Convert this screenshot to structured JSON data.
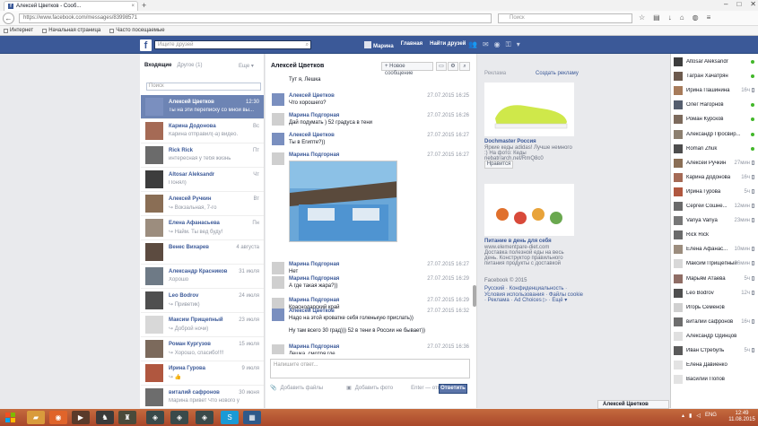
{
  "browser": {
    "tab_title": "Алексей Цветков - Сооб...",
    "new_tab": "+",
    "url": "https://www.facebook.com/messages/83998571",
    "search_placeholder": "Поиск",
    "bookmarks": [
      "Интернет",
      "Начальная страница",
      "Часто посещаемые"
    ]
  },
  "fb_header": {
    "logo": "f",
    "search_placeholder": "Ищите друзей",
    "nav": [
      "Марина",
      "Главная",
      "Найти друзей"
    ]
  },
  "left": {
    "tab_inbox": "Входящие",
    "tab_others": "Другое (1)",
    "tab_more": "Еще ▾",
    "search_placeholder": "Поиск",
    "conversations": [
      {
        "name": "Алексей Цветков",
        "snippet": "Ты на эти переписку со мной вы...",
        "time": "12:30",
        "color": "#7a8fbf"
      },
      {
        "name": "Карина Додонова",
        "snippet": "Карина отправил(-а) видео.",
        "time": "Вс",
        "color": "#a56a55"
      },
      {
        "name": "Rick Rick",
        "snippet": "интересная у тебя жизнь",
        "time": "Пт",
        "color": "#6b6b6b"
      },
      {
        "name": "Altosar Aleksandr",
        "snippet": "Понял)",
        "time": "Чт",
        "color": "#3d3d3d"
      },
      {
        "name": "Алексей Ручкин",
        "snippet": "↪ Вокзальная, 7-го",
        "time": "Вт",
        "color": "#8a6e55"
      },
      {
        "name": "Елена Афанасьева",
        "snippet": "↪ Найм. Ты вед буду!",
        "time": "Пн",
        "color": "#9c8d7e"
      },
      {
        "name": "Венес Вихарев",
        "snippet": "",
        "time": "4 августа",
        "color": "#5c4b40"
      },
      {
        "name": "Александр Красников",
        "snippet": "Хорошо",
        "time": "31 июля",
        "color": "#6e7a86"
      },
      {
        "name": "Leo Bodrov",
        "snippet": "↪ Приветик)",
        "time": "24 июля",
        "color": "#4f4f4f"
      },
      {
        "name": "Максим Прищепный",
        "snippet": "↪ Доброй ночи)",
        "time": "23 июля",
        "color": "#d8d8d8"
      },
      {
        "name": "Роман Кургузов",
        "snippet": "↪ Хорошо, спасибо!!!!",
        "time": "15 июля",
        "color": "#7c6a5c"
      },
      {
        "name": "Ирина Гурова",
        "snippet": "↪ 👍",
        "time": "9 июля",
        "color": "#b0573f"
      },
      {
        "name": "виталий сафронов",
        "snippet": "Марина привет Что нового у",
        "time": "30 июня",
        "color": "#6d6d6d"
      }
    ]
  },
  "chat": {
    "title": "Алексей Цветков",
    "new_message": "+ Новое сообщение",
    "messages": [
      {
        "author": "",
        "text": "Тут я, Лешка",
        "time": "",
        "ava": ""
      },
      {
        "author": "Алексей Цветков",
        "text": "Что хорошего?",
        "time": "27.07.2015 16:25",
        "ava": "#7a8fbf"
      },
      {
        "author": "Марина Подгорная",
        "text": "Дай подумать ) 52 градуса в тени",
        "time": "27.07.2015 16:26",
        "ava": "#cfcfcf"
      },
      {
        "author": "Алексей Цветков",
        "text": "Ты в Египте?))",
        "time": "27.07.2015 16:27",
        "ava": "#7a8fbf"
      },
      {
        "author": "Марина Подгорная",
        "text": "",
        "time": "27.07.2015 16:27",
        "ava": "#cfcfcf"
      },
      {
        "author": "Марина Подгорная",
        "text": "Нет",
        "time": "27.07.2015 16:27",
        "ava": "#cfcfcf"
      },
      {
        "author": "Марина Подгорная",
        "text": "А где такая жара?))",
        "time": "27.07.2015 16:29",
        "ava": "#cfcfcf"
      },
      {
        "author": "Марина Подгорная",
        "text": "Краснодарский край",
        "time": "27.07.2015 16:29",
        "ava": "#cfcfcf"
      },
      {
        "author": "Алексей Цветков",
        "text": "Надо на этой кроватке себя голенькую прислать))",
        "time": "27.07.2015 16:32",
        "ava": "#7a8fbf"
      },
      {
        "author": "",
        "text": "Ну там всего 30 град))) 52 в тени в России не бывает))",
        "time": "",
        "ava": ""
      },
      {
        "author": "Марина Подгорная",
        "text": "Лешка, смотря где",
        "time": "27.07.2015 16:36",
        "ava": "#cfcfcf"
      }
    ],
    "composer_placeholder": "Напишите ответ...",
    "add_files": "Добавить файлы",
    "add_photo": "Добавить фото",
    "enter_hint": "Enter — отправить",
    "send": "Ответить"
  },
  "ads": {
    "header": "Реклама",
    "create": "Создать рекламу",
    "ad1_title": "Dochmaster Россия",
    "ad1_text": "Яркие кеды adidas! Лучше немного :) На фото: Кеды nebatr/arch.net/RmQ8c0",
    "like": "Нравится",
    "ad2_title": "Питание в день для себя",
    "ad2_site": "www.elementpare-diet.com",
    "ad2_text": "Доставка полезной еды на весь день. Конструктор правильного питания продукты с доставкой",
    "copyright": "Facebook © 2015",
    "links": "Русский · Конфиденциальность · Условия использования · Файлы cookie · Реклама · Ad Choices ▷ · Ещё ▾"
  },
  "friends": [
    {
      "name": "Altosar Aleksandr",
      "status": "",
      "online": true,
      "color": "#3d3d3d"
    },
    {
      "name": "Тагран Хачатрян",
      "status": "",
      "online": true,
      "color": "#6c5a4d"
    },
    {
      "name": "Ирина Пашинина",
      "status": "16ч",
      "online": false,
      "color": "#a77b5a"
    },
    {
      "name": "Олег Нагорнов",
      "status": "",
      "online": true,
      "color": "#555e6e"
    },
    {
      "name": "Роман Курсков",
      "status": "",
      "online": true,
      "color": "#7c6a5c"
    },
    {
      "name": "Александр Просвир...",
      "status": "",
      "online": true,
      "color": "#8c7f6f"
    },
    {
      "name": "Roman Zhuk",
      "status": "",
      "online": true,
      "color": "#4d4d4d"
    },
    {
      "name": "Алексей Ручкин",
      "status": "27мин",
      "online": false,
      "color": "#8a6e55"
    },
    {
      "name": "Карина Додонова",
      "status": "16ч",
      "online": false,
      "color": "#a56a55"
    },
    {
      "name": "Ирина Гурова",
      "status": "5ч",
      "online": false,
      "color": "#b0573f"
    },
    {
      "name": "Сергей Сошне...",
      "status": "12мин",
      "online": false,
      "color": "#6a6a6a"
    },
    {
      "name": "Vanya Vanya",
      "status": "23мин",
      "online": false,
      "color": "#777"
    },
    {
      "name": "Rick Rick",
      "status": "",
      "online": false,
      "color": "#6b6b6b"
    },
    {
      "name": "Елена Афанас...",
      "status": "10мин",
      "online": false,
      "color": "#9c8d7e"
    },
    {
      "name": "Максим Прищепный",
      "status": "26мин",
      "online": false,
      "color": "#d8d8d8"
    },
    {
      "name": "Марьям Атаева",
      "status": "5ч",
      "online": false,
      "color": "#8f6d65"
    },
    {
      "name": "Leo Bodrov",
      "status": "12ч",
      "online": false,
      "color": "#4f4f4f"
    },
    {
      "name": "Игорь Семенов",
      "status": "",
      "online": false,
      "color": "#d0d0d0"
    },
    {
      "name": "виталий сафронов",
      "status": "16ч",
      "online": false,
      "color": "#6d6d6d"
    },
    {
      "name": "Александр Одинцов",
      "status": "",
      "online": false,
      "color": "#e0e0e0"
    },
    {
      "name": "Иван Стребуль",
      "status": "5ч",
      "online": false,
      "color": "#5a5a5a"
    },
    {
      "name": "Елена Давиенко",
      "status": "",
      "online": false,
      "color": "#e3e3e3"
    },
    {
      "name": "Василий Попов",
      "status": "",
      "online": false,
      "color": "#e3e3e3"
    }
  ],
  "chat_tab": "Алексей Цветков",
  "taskbar": {
    "lang": "ENG",
    "time": "12:49",
    "date": "11.08.2015"
  }
}
